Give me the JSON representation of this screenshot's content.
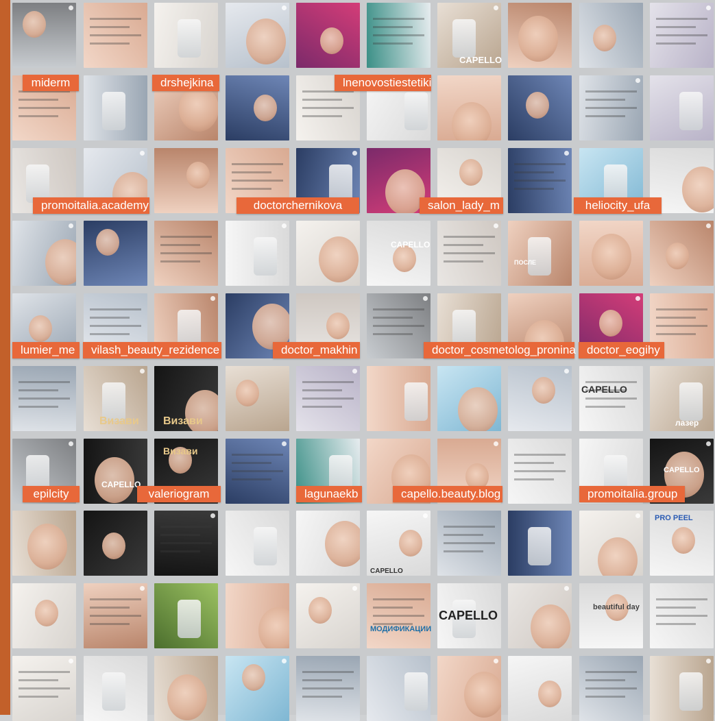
{
  "labels": {
    "miderm": "miderm",
    "drshejkina": "drshejkina",
    "lnenovostiestetiki": "lnenovostiestetiki",
    "promoitalia_academy": "promoitalia.academy",
    "doctorchernikova": "doctorchernikova",
    "salon_lady_m": "salon_lady_m",
    "heliocity_ufa": "heliocity_ufa",
    "lumier_me": "lumier_me",
    "vilash_beauty_rezidence": "vilash_beauty_rezidence",
    "doctor_makhin": "doctor_makhin",
    "doctor_cosmetolog_pronina": "doctor_cosmetolog_pronina",
    "doctor_eogihy": "doctor_eogihy",
    "epilcity": "epilcity",
    "valeriogram": "valeriogram",
    "lagunaekb": "lagunaekb",
    "capello_beauty_blog": "capello.beauty.blog",
    "promoitalia_group": "promoitalia.group"
  },
  "overlays": {
    "capello_1": "CAPELLO",
    "capello_2": "CAPELLO",
    "capello_3": "CAPELLO",
    "capello_4": "CAPELLO",
    "capello_5": "CAPELLO",
    "capello_6": "CAPELLO",
    "capello_7": "CAPELLO",
    "mod": "МОДИФИКАЦИИ",
    "vizavi_1": "Визави",
    "vizavi_2": "Визави",
    "vizavi_3": "Визави",
    "lazer": "лазер",
    "beauty": "beautiful day",
    "posle": "ПОСЛЕ",
    "pro_peel": "PRO PEEL"
  },
  "colors": {
    "label_bg": "#e8683a",
    "left_border": "#c2602a",
    "background": "#c9cbcd"
  }
}
